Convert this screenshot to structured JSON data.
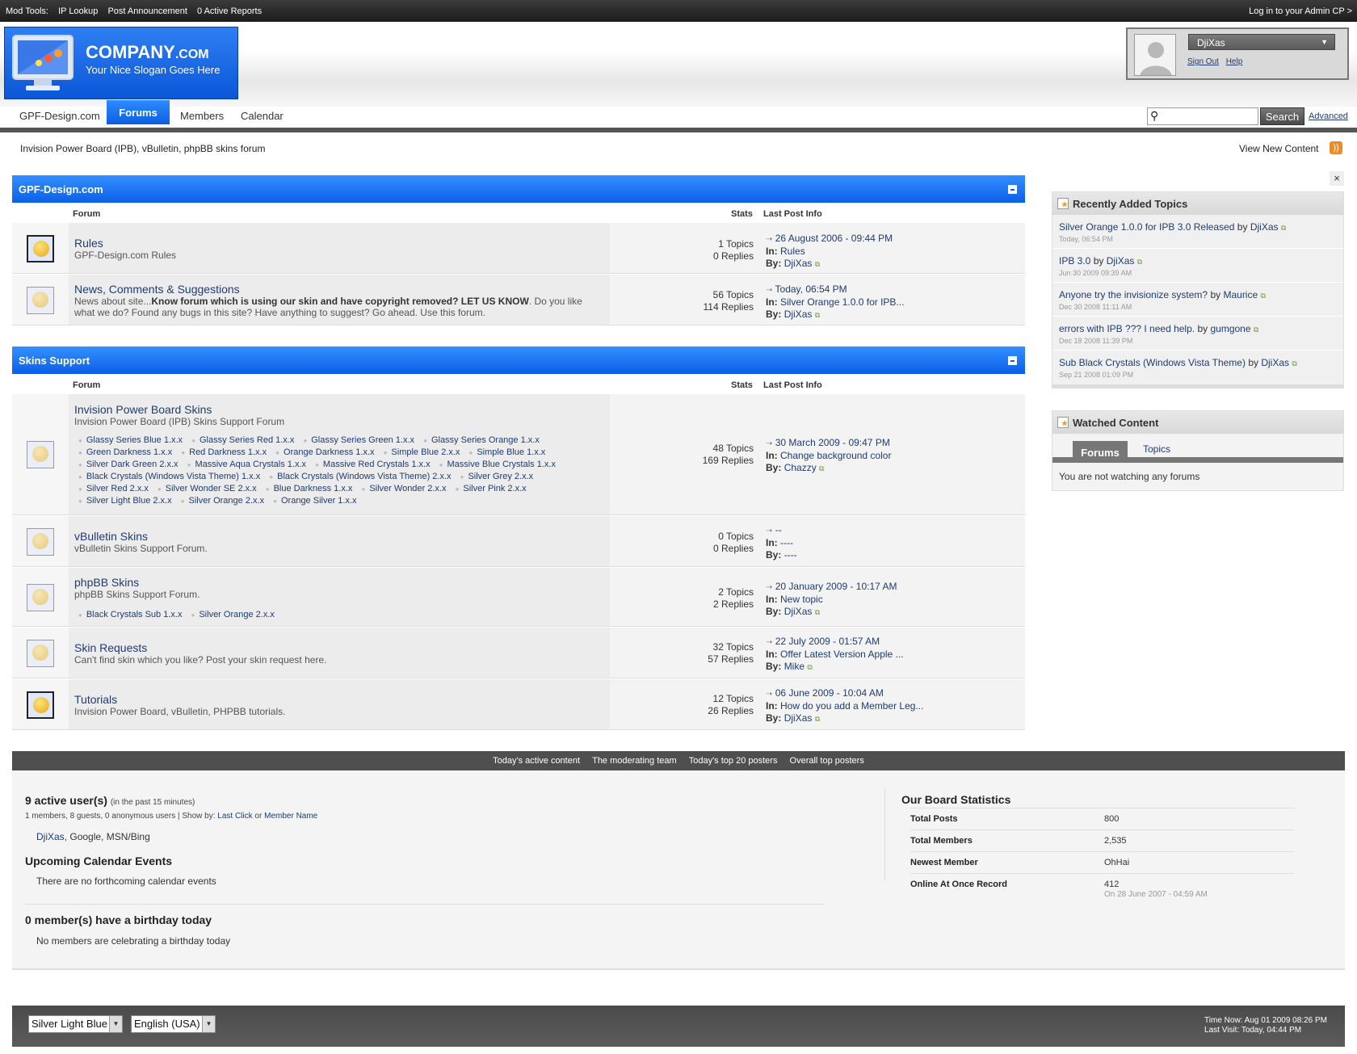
{
  "modbar": {
    "label": "Mod Tools:",
    "items": [
      "IP Lookup",
      "Post Announcement",
      "0 Active Reports"
    ],
    "admin_link": "Log in to your Admin CP >"
  },
  "logo": {
    "name": "COMPANY",
    "tld": ".COM",
    "slogan": "Your Nice Slogan Goes Here"
  },
  "user": {
    "name": "DjiXas",
    "sign_out": "Sign Out",
    "help": "Help"
  },
  "nav": {
    "tabs": [
      "GPF-Design.com",
      "Forums",
      "Members",
      "Calendar"
    ],
    "active": "Forums"
  },
  "search": {
    "button": "Search",
    "advanced": "Advanced",
    "value": ""
  },
  "page": {
    "subtitle": "Invision Power Board (IPB), vBulletin, phpBB skins forum",
    "view_new": "View New Content"
  },
  "columns": {
    "forum": "Forum",
    "stats": "Stats",
    "last": "Last Post Info"
  },
  "categories": [
    {
      "title": "GPF-Design.com",
      "forums": [
        {
          "title": "Rules",
          "desc": "GPF-Design.com Rules",
          "topics": "1 Topics",
          "replies": "0 Replies",
          "date": "26 August 2006 - 09:44 PM",
          "in": "Rules",
          "by": "DjiXas"
        },
        {
          "title": "News, Comments & Suggestions",
          "desc_pre": "News about site...",
          "desc_bold": "Know forum which is using our skin and have copyright removed? LET US KNOW",
          "desc_post": ". Do you like what we do? Found any bugs in this site? Have anything to suggest? Go ahead. Use this forum.",
          "topics": "56 Topics",
          "replies": "114 Replies",
          "date": "Today, 06:54 PM",
          "in": "Silver Orange 1.0.0 for IPB...",
          "by": "DjiXas"
        }
      ]
    },
    {
      "title": "Skins Support",
      "forums": [
        {
          "title": "Invision Power Board Skins",
          "desc": "Invision Power Board (IPB) Skins Support Forum",
          "subforums": [
            "Glassy Series Blue 1.x.x",
            "Glassy Series Red 1.x.x",
            "Glassy Series Green 1.x.x",
            "Glassy Series Orange 1.x.x",
            "Green Darkness 1.x.x",
            "Red Darkness 1.x.x",
            "Orange Darkness 1.x.x",
            "Simple Blue 2.x.x",
            "Simple Blue 1.x.x",
            "Silver Dark Green 2.x.x",
            "Massive Aqua Crystals 1.x.x",
            "Massive Red Crystals 1.x.x",
            "Massive Blue Crystals 1.x.x",
            "Black Crystals (Windows Vista Theme) 1.x.x",
            "Black Crystals (Windows Vista Theme) 2.x.x",
            "Silver Grey 2.x.x",
            "Silver Red 2.x.x",
            "Silver Wonder SE 2.x.x",
            "Blue Darkness 1.x.x",
            "Silver Wonder 2.x.x",
            "Silver Pink 2.x.x",
            "Silver Light Blue 2.x.x",
            "Silver Orange 2.x.x",
            "Orange Silver 1.x.x"
          ],
          "topics": "48 Topics",
          "replies": "169 Replies",
          "date": "30 March 2009 - 09:47 PM",
          "in": "Change background color",
          "by": "Chazzy"
        },
        {
          "title": "vBulletin Skins",
          "desc": "vBulletin Skins Support Forum.",
          "topics": "0 Topics",
          "replies": "0 Replies",
          "date": "--",
          "in": "----",
          "by": "----"
        },
        {
          "title": "phpBB Skins",
          "desc": "phpBB Skins Support Forum.",
          "subforums": [
            "Black Crystals Sub 1.x.x",
            "Silver Orange 2.x.x"
          ],
          "topics": "2 Topics",
          "replies": "2 Replies",
          "date": "20 January 2009 - 10:17 AM",
          "in": "New topic",
          "by": "DjiXas"
        },
        {
          "title": "Skin Requests",
          "desc": "Can't find skin which you like? Post your skin request here.",
          "topics": "32 Topics",
          "replies": "57 Replies",
          "date": "22 July 2009 - 01:57 AM",
          "in": "Offer Latest Version Apple ...",
          "by": "Mike"
        },
        {
          "title": "Tutorials",
          "desc": "Invision Power Board, vBulletin, PHPBB tutorials.",
          "topics": "12 Topics",
          "replies": "26 Replies",
          "date": "06 June 2009 - 10:04 AM",
          "in": "How do you add a Member Leg...",
          "by": "DjiXas"
        }
      ]
    }
  ],
  "labels": {
    "in": "In:",
    "by": "By:",
    "by_word": "by"
  },
  "recent": {
    "title": "Recently Added Topics",
    "items": [
      {
        "title": "Silver Orange 1.0.0 for IPB 3.0 Released",
        "author": "DjiXas",
        "date": "Today, 06:54 PM"
      },
      {
        "title": "IPB 3.0",
        "author": "DjiXas",
        "date": "Jun 30 2009 09:39 AM"
      },
      {
        "title": "Anyone try the invisionize system?",
        "author": "Maurice",
        "date": "Dec 30 2008 11:11 AM"
      },
      {
        "title": "errors with IPB ??? I need help.",
        "author": "gumgone",
        "date": "Dec 18 2008 11:39 PM"
      },
      {
        "title": "Sub Black Crystals (Windows Vista Theme)",
        "author": "DjiXas",
        "date": "Sep 21 2008 01:09 PM"
      }
    ]
  },
  "watched": {
    "title": "Watched Content",
    "tabs": [
      "Forums",
      "Topics"
    ],
    "message": "You are not watching any forums"
  },
  "statsbar": [
    "Today's active content",
    "The moderating team",
    "Today's top 20 posters",
    "Overall top posters"
  ],
  "active_users": {
    "heading": "9 active user(s)",
    "note": "(in the past 15 minutes)",
    "summary": "1 members, 8 guests, 0 anonymous users | Show by:",
    "show_last": "Last Click",
    "or": "or",
    "show_name": "Member Name",
    "member": "DjiXas",
    "others": ", Google, MSN/Bing"
  },
  "calendar": {
    "heading": "Upcoming Calendar Events",
    "text": "There are no forthcoming calendar events"
  },
  "birthdays": {
    "heading": "0 member(s) have a birthday today",
    "text": "No members are celebrating a birthday today"
  },
  "board_stats": {
    "heading": "Our Board Statistics",
    "rows": [
      {
        "label": "Total Posts",
        "value": "800"
      },
      {
        "label": "Total Members",
        "value": "2,535"
      },
      {
        "label": "Newest Member",
        "value": "OhHai"
      },
      {
        "label": "Online At Once Record",
        "value": "412",
        "sub": "On 28 June 2007 - 04:59 AM"
      }
    ]
  },
  "footer": {
    "skin": "Silver Light Blue",
    "language": "English (USA)",
    "time_now": "Time Now: Aug 01 2009 08:26 PM",
    "last_visit": "Last Visit: Today, 04:44 PM"
  }
}
